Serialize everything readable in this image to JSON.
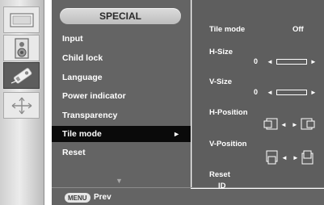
{
  "menu_title": "SPECIAL",
  "menu_items": [
    {
      "label": "Input"
    },
    {
      "label": "Child lock"
    },
    {
      "label": "Language"
    },
    {
      "label": "Power indicator"
    },
    {
      "label": "Transparency"
    },
    {
      "label": "Tile mode",
      "selected": true
    },
    {
      "label": "Reset"
    }
  ],
  "selected_arrow": "►",
  "scroll_down_arrow": "▼",
  "footer": {
    "key_label": "MENU",
    "action_label": "Prev"
  },
  "tile_mode": {
    "label": "Tile mode",
    "value": "Off",
    "h_size": {
      "label": "H-Size",
      "value": "0"
    },
    "v_size": {
      "label": "V-Size",
      "value": "0"
    },
    "h_position": {
      "label": "H-Position"
    },
    "v_position": {
      "label": "V-Position"
    },
    "reset_label": "Reset",
    "id_label": "ID"
  },
  "left_arrow": "◄",
  "right_arrow": "►",
  "side_icons": [
    "picture-icon",
    "audio-icon",
    "special-settings-icon",
    "display-position-icon"
  ],
  "colors": {
    "menu_bg": "#646464",
    "selected_bg": "#0a0a0a",
    "panel_bg": "#5e5e5e",
    "text": "#ffffff"
  }
}
